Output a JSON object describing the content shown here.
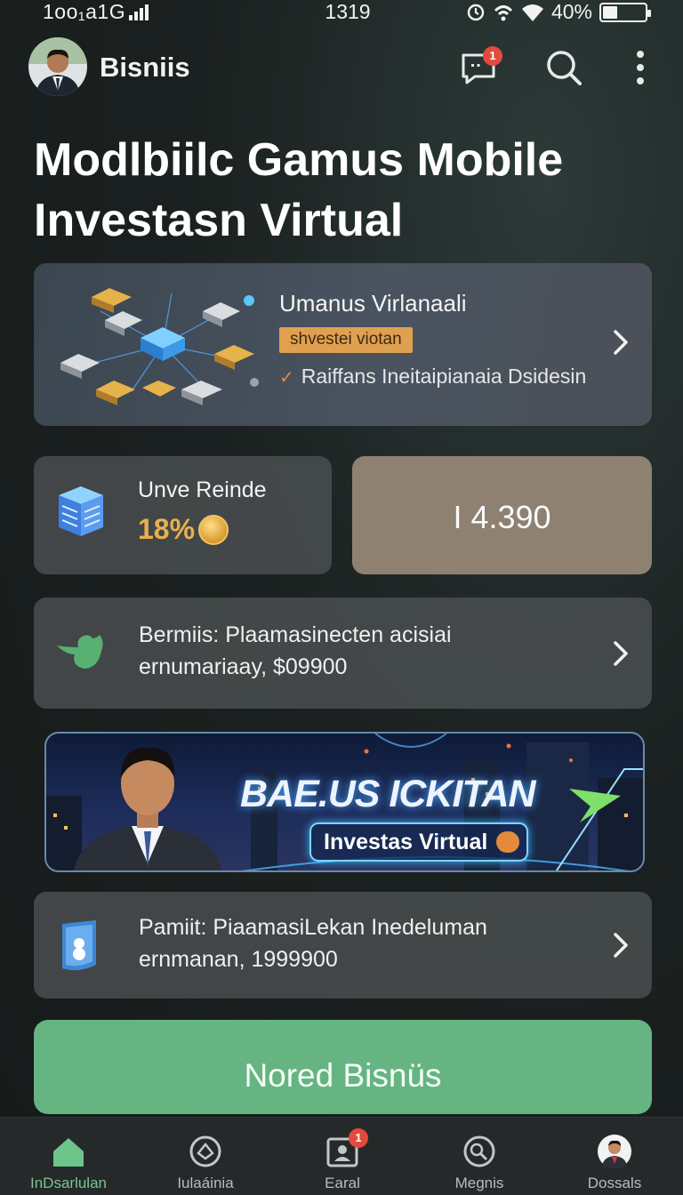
{
  "status_bar": {
    "left": "1oo₁a1G",
    "time": "1319",
    "battery": "40%",
    "battery_level": 0.4
  },
  "header": {
    "title": "Bisniis",
    "messages_badge": "1"
  },
  "headline": {
    "line1": "Modlbiilc Gamus Mobile",
    "line2": "Investasn Virtual"
  },
  "featured": {
    "title": "Umanus Virlanaali",
    "tag": "shvestei viotan",
    "description": "Raiffans Ineitaipianaia Dsidesin"
  },
  "stat": {
    "label": "Unve Reinde",
    "value": "18%"
  },
  "balance": {
    "value": "I 4.390"
  },
  "info_cards": [
    {
      "line1": "Bermiis: Plaamasinecten acisiai",
      "line2": "ernumariaay, $09900"
    },
    {
      "line1": "Pamiit: PiaamasiLekan Inedeluman",
      "line2": "ernmanan, 1999900"
    }
  ],
  "banner": {
    "title": "BAE.US ICKITAN",
    "pill": "Investas Virtual"
  },
  "cta": {
    "label": "Nored Bisnüs"
  },
  "bottom_nav": {
    "items": [
      {
        "label": "InDsarlulan",
        "icon": "home-icon",
        "active": true
      },
      {
        "label": "Iulaáinia",
        "icon": "explore-icon",
        "active": false
      },
      {
        "label": "Earal",
        "icon": "portfolio-icon",
        "active": false,
        "badge": "1"
      },
      {
        "label": "Megnis",
        "icon": "search-people-icon",
        "active": false
      },
      {
        "label": "Dossals",
        "icon": "profile-icon",
        "active": false
      }
    ]
  },
  "colors": {
    "accent_green": "#66b482",
    "badge_red": "#e24a3b",
    "tag_orange": "#e0a050",
    "balance_card": "#8e8172"
  }
}
